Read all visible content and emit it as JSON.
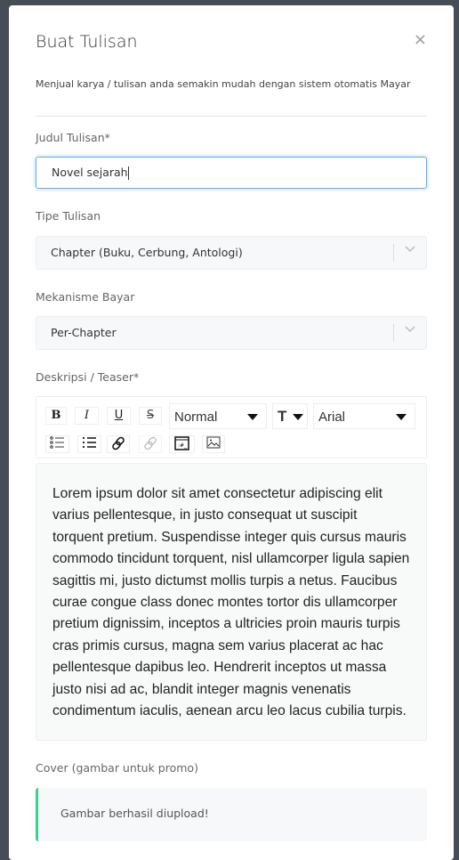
{
  "modal": {
    "title": "Buat Tulisan",
    "close_icon": "×",
    "subtitle": "Menjual karya / tulisan anda semakin mudah dengan sistem otomatis Mayar"
  },
  "form": {
    "judul": {
      "label": "Judul Tulisan*",
      "value": "Novel sejarah"
    },
    "tipe": {
      "label": "Tipe Tulisan",
      "value": "Chapter (Buku, Cerbung, Antologi)"
    },
    "mekanisme": {
      "label": "Mekanisme Bayar",
      "value": "Per-Chapter"
    },
    "deskripsi": {
      "label": "Deskripsi / Teaser*",
      "toolbar": {
        "bold": "B",
        "italic": "I",
        "underline": "U",
        "strike": "S",
        "heading": "Normal",
        "font_size_icon": "T",
        "font": "Arial",
        "icons": [
          "bullet-list-icon",
          "numbered-list-icon",
          "link-icon",
          "unlink-icon",
          "code-view-icon",
          "image-icon"
        ]
      },
      "content": "Lorem ipsum dolor sit amet consectetur adipiscing elit varius pellentesque, in justo consequat ut suscipit torquent pretium. Suspendisse integer quis cursus mauris commodo tincidunt torquent, nisl ullamcorper ligula sapien sagittis mi, justo dictumst mollis turpis a netus. Faucibus curae congue class donec montes tortor dis ullamcorper pretium dignissim, inceptos a ultricies proin mauris turpis cras primis cursus, magna sem varius placerat ac hac pellentesque dapibus leo. Hendrerit inceptos ut massa justo nisi ad ac, blandit integer magnis venenatis condimentum iaculis, aenean arcu leo lacus cubilia turpis."
    },
    "cover": {
      "label": "Cover (gambar untuk promo)",
      "status": "Gambar berhasil diupload!"
    }
  },
  "colors": {
    "backdrop": "#474d57",
    "focus": "#66afe9",
    "success": "#3ecf8e"
  }
}
